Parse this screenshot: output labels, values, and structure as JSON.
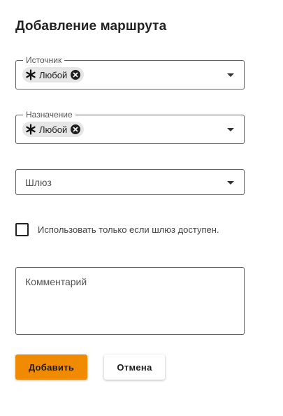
{
  "dialog": {
    "title": "Добавление маршрута"
  },
  "source": {
    "legend": "Источник",
    "chip_label": "Любой",
    "chip_icon": "asterisk-icon"
  },
  "destination": {
    "legend": "Назначение",
    "chip_label": "Любой",
    "chip_icon": "asterisk-icon"
  },
  "gateway": {
    "placeholder": "Шлюз"
  },
  "only_if_available": {
    "label": "Использовать только если шлюз доступен.",
    "checked": false
  },
  "comment": {
    "placeholder": "Комментарий"
  },
  "actions": {
    "add_label": "Добавить",
    "cancel_label": "Отмена"
  },
  "colors": {
    "accent": "#f08a00",
    "chip_bg": "#e6e6e6",
    "border": "#5f5f5f"
  }
}
